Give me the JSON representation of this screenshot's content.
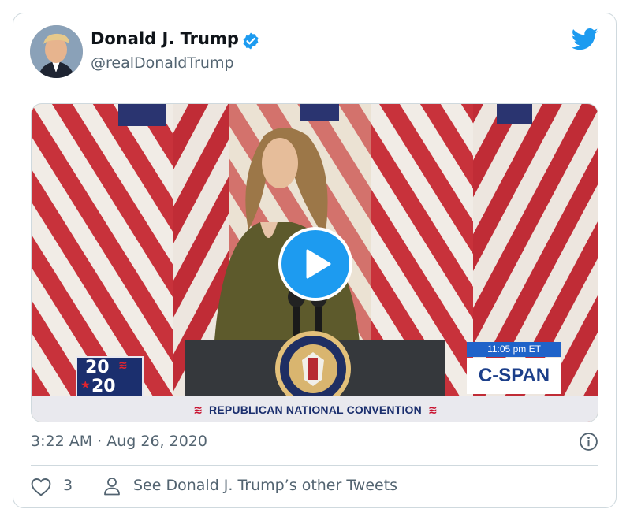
{
  "tweet": {
    "author_name": "Donald J. Trump",
    "handle": "@realDonaldTrump",
    "timestamp": "3:22 AM · Aug 26, 2020",
    "like_count": "3",
    "other_tweets_label": "See Donald J. Trump’s other Tweets"
  },
  "video": {
    "badge_top": "20",
    "badge_bottom": "20",
    "cspan_time": "11:05 pm ET",
    "cspan_logo": "C-SPAN",
    "lower_third": "REPUBLICAN NATIONAL CONVENTION"
  },
  "icons": {
    "verified": "verified-badge-icon",
    "twitter": "twitter-bird-icon",
    "play": "play-icon",
    "info": "info-icon",
    "like": "heart-icon",
    "profile": "person-icon"
  },
  "colors": {
    "accent": "#1d9bf0",
    "secondary_text": "#536471",
    "border": "#cfd9de"
  }
}
